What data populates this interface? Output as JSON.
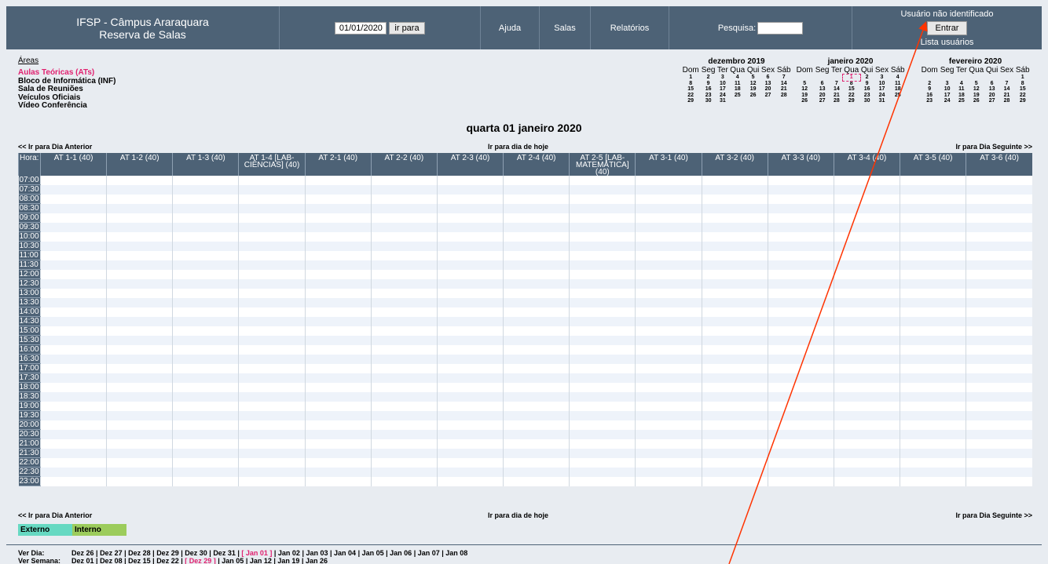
{
  "header": {
    "title_line1": "IFSP - Câmpus Araraquara",
    "title_line2": "Reserva de Salas",
    "date_value": "01/01/2020",
    "goto_label": "ir para",
    "help": "Ajuda",
    "rooms": "Salas",
    "reports": "Relatórios",
    "search_label": "Pesquisa:",
    "user_status": "Usuário não identificado",
    "login": "Entrar",
    "user_list": "Lista usuários"
  },
  "areas": {
    "title": "Áreas",
    "items": [
      "Aulas Teóricas (ATs)",
      "Bloco de Informática (INF)",
      "Sala de Reuniões",
      "Veículos Oficiais",
      "Vídeo Conferência"
    ]
  },
  "calendars": [
    {
      "title": "dezembro 2019",
      "weeks": [
        [
          "1",
          "2",
          "3",
          "4",
          "5",
          "6",
          "7"
        ],
        [
          "8",
          "9",
          "10",
          "11",
          "12",
          "13",
          "14"
        ],
        [
          "15",
          "16",
          "17",
          "18",
          "19",
          "20",
          "21"
        ],
        [
          "22",
          "23",
          "24",
          "25",
          "26",
          "27",
          "28"
        ],
        [
          "29",
          "30",
          "31",
          "",
          "",
          "",
          ""
        ]
      ]
    },
    {
      "title": "janeiro 2020",
      "weeks": [
        [
          "",
          "",
          "",
          "1",
          "2",
          "3",
          "4"
        ],
        [
          "5",
          "6",
          "7",
          "8",
          "9",
          "10",
          "11"
        ],
        [
          "12",
          "13",
          "14",
          "15",
          "16",
          "17",
          "18"
        ],
        [
          "19",
          "20",
          "21",
          "22",
          "23",
          "24",
          "25"
        ],
        [
          "26",
          "27",
          "28",
          "29",
          "30",
          "31",
          ""
        ]
      ]
    },
    {
      "title": "fevereiro 2020",
      "weeks": [
        [
          "",
          "",
          "",
          "",
          "",
          "",
          "1"
        ],
        [
          "2",
          "3",
          "4",
          "5",
          "6",
          "7",
          "8"
        ],
        [
          "9",
          "10",
          "11",
          "12",
          "13",
          "14",
          "15"
        ],
        [
          "16",
          "17",
          "18",
          "19",
          "20",
          "21",
          "22"
        ],
        [
          "23",
          "24",
          "25",
          "26",
          "27",
          "28",
          "29"
        ]
      ]
    }
  ],
  "weekdays": [
    "Dom",
    "Seg",
    "Ter",
    "Qua",
    "Qui",
    "Sex",
    "Sáb"
  ],
  "current_date": "quarta 01 janeiro 2020",
  "nav": {
    "prev": "<< Ir para Dia Anterior",
    "today": "Ir para dia de hoje",
    "next": "Ir para Dia Seguinte >>"
  },
  "grid": {
    "hour_label": "Hora:",
    "rooms": [
      "AT 1-1 (40)",
      "AT 1-2 (40)",
      "AT 1-3 (40)",
      "AT 1-4 [LAB-CIÊNCIAS] (40)",
      "AT 2-1 (40)",
      "AT 2-2 (40)",
      "AT 2-3 (40)",
      "AT 2-4 (40)",
      "AT 2-5 [LAB-MATEMÁTICA] (40)",
      "AT 3-1 (40)",
      "AT 3-2 (40)",
      "AT 3-3 (40)",
      "AT 3-4 (40)",
      "AT 3-5 (40)",
      "AT 3-6 (40)"
    ],
    "times": [
      "07:00",
      "07:30",
      "08:00",
      "08:30",
      "09:00",
      "09:30",
      "10:00",
      "10:30",
      "11:00",
      "11:30",
      "12:00",
      "12:30",
      "13:00",
      "13:30",
      "14:00",
      "14:30",
      "15:00",
      "15:30",
      "16:00",
      "16:30",
      "17:00",
      "17:30",
      "18:00",
      "18:30",
      "19:00",
      "19:30",
      "20:00",
      "20:30",
      "21:00",
      "21:30",
      "22:00",
      "22:30",
      "23:00"
    ]
  },
  "legend": [
    {
      "label": "Externo",
      "color": "#66d9c2"
    },
    {
      "label": "Interno",
      "color": "#9ccc5c"
    }
  ],
  "footer": {
    "day_label": "Ver Dia:",
    "days": [
      "Dez 26",
      "Dez 27",
      "Dez 28",
      "Dez 29",
      "Dez 30",
      "Dez 31",
      "[ Jan 01 ]",
      "Jan 02",
      "Jan 03",
      "Jan 04",
      "Jan 05",
      "Jan 06",
      "Jan 07",
      "Jan 08"
    ],
    "week_label": "Ver Semana:",
    "weeks": [
      "Dez 01",
      "Dez 08",
      "Dez 15",
      "Dez 22",
      "[ Dez 29 ]",
      "Jan 05",
      "Jan 12",
      "Jan 19",
      "Jan 26"
    ]
  },
  "colors": {
    "banner": "#4d6276",
    "highlight": "#e0216f",
    "annotation_arrow": "#ff3300"
  }
}
